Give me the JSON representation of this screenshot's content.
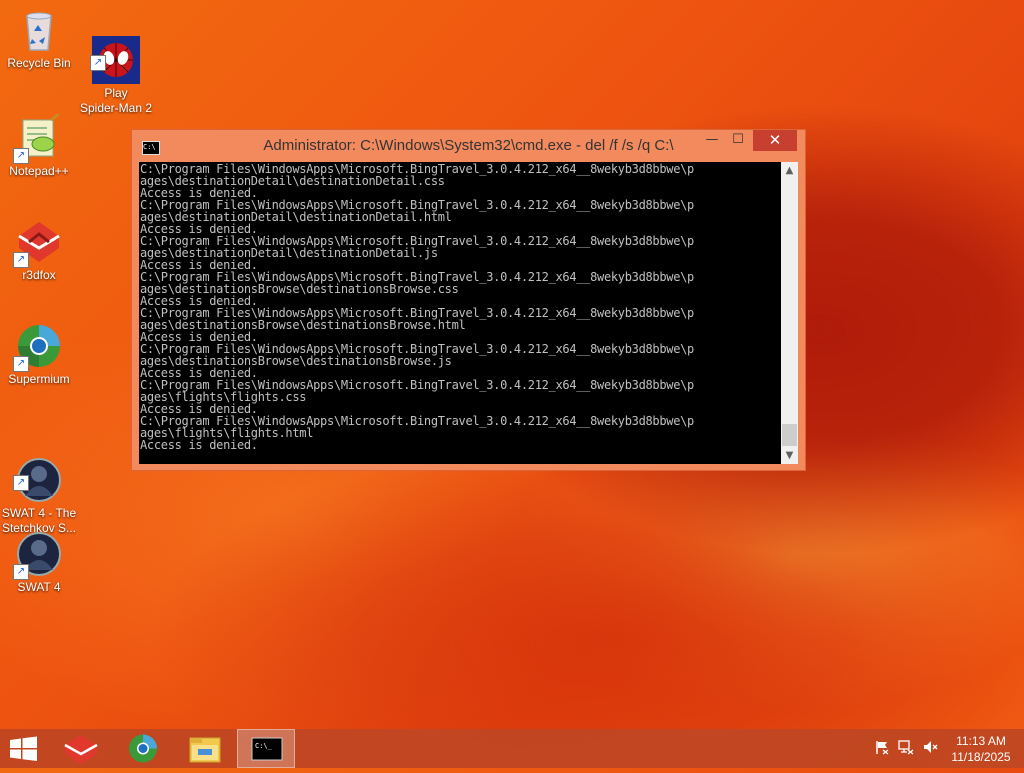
{
  "desktop": {
    "icons": [
      {
        "label": "Recycle Bin",
        "icon": "recycle-bin-icon"
      },
      {
        "label": "Play\nSpider-Man 2",
        "icon": "spiderman-icon"
      },
      {
        "label": "Notepad++",
        "icon": "notepad-plus-plus-icon"
      },
      {
        "label": "r3dfox",
        "icon": "r3dfox-icon"
      },
      {
        "label": "Supermium",
        "icon": "supermium-icon"
      },
      {
        "label": "SWAT 4 - The\nStetchkov S...",
        "icon": "swat4-stetchkov-icon"
      },
      {
        "label": "SWAT 4",
        "icon": "swat4-icon"
      }
    ]
  },
  "cmd": {
    "title": "Administrator: C:\\Windows\\System32\\cmd.exe - del  /f /s /q C:\\",
    "icon_glyph": "C:\\",
    "min_glyph": "—",
    "max_glyph": "☐",
    "close_glyph": "✕",
    "scroll_up_glyph": "▲",
    "scroll_down_glyph": "▼",
    "console_text": "C:\\Program Files\\WindowsApps\\Microsoft.BingTravel_3.0.4.212_x64__8wekyb3d8bbwe\\p\nages\\destinationDetail\\destinationDetail.css\nAccess is denied.\nC:\\Program Files\\WindowsApps\\Microsoft.BingTravel_3.0.4.212_x64__8wekyb3d8bbwe\\p\nages\\destinationDetail\\destinationDetail.html\nAccess is denied.\nC:\\Program Files\\WindowsApps\\Microsoft.BingTravel_3.0.4.212_x64__8wekyb3d8bbwe\\p\nages\\destinationDetail\\destinationDetail.js\nAccess is denied.\nC:\\Program Files\\WindowsApps\\Microsoft.BingTravel_3.0.4.212_x64__8wekyb3d8bbwe\\p\nages\\destinationsBrowse\\destinationsBrowse.css\nAccess is denied.\nC:\\Program Files\\WindowsApps\\Microsoft.BingTravel_3.0.4.212_x64__8wekyb3d8bbwe\\p\nages\\destinationsBrowse\\destinationsBrowse.html\nAccess is denied.\nC:\\Program Files\\WindowsApps\\Microsoft.BingTravel_3.0.4.212_x64__8wekyb3d8bbwe\\p\nages\\destinationsBrowse\\destinationsBrowse.js\nAccess is denied.\nC:\\Program Files\\WindowsApps\\Microsoft.BingTravel_3.0.4.212_x64__8wekyb3d8bbwe\\p\nages\\flights\\flights.css\nAccess is denied.\nC:\\Program Files\\WindowsApps\\Microsoft.BingTravel_3.0.4.212_x64__8wekyb3d8bbwe\\p\nages\\flights\\flights.html\nAccess is denied."
  },
  "taskbar": {
    "pinned": [
      {
        "icon": "start-icon"
      },
      {
        "icon": "r3dfox-taskbar-icon"
      },
      {
        "icon": "supermium-taskbar-icon"
      },
      {
        "icon": "file-explorer-icon"
      },
      {
        "icon": "cmd-taskbar-icon"
      }
    ],
    "tray_icons": [
      "action-center-flag-icon",
      "network-icon",
      "volume-muted-icon"
    ],
    "time": "11:13 AM",
    "date": "11/18/2025"
  },
  "colors": {
    "wallpaper": "#ee5410",
    "taskbar": "#be4623",
    "window_frame": "#f38a5e",
    "close_button": "#c7402f",
    "console_bg": "#000000",
    "console_fg": "#c0c0c0"
  }
}
